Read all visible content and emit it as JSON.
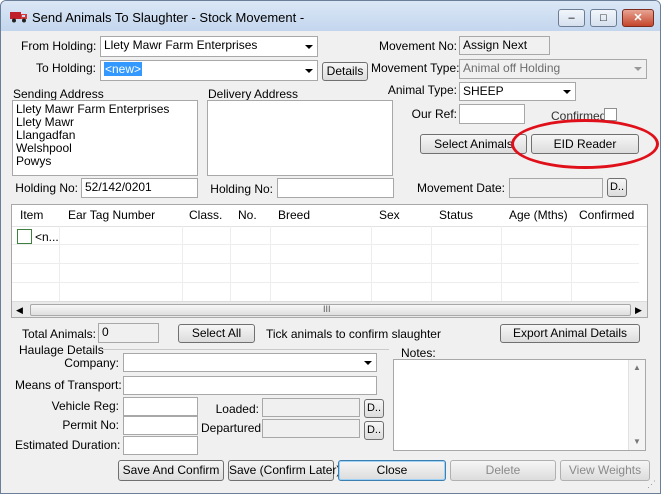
{
  "window": {
    "title": "Send Animals To Slaughter - Stock Movement -",
    "minimize_glyph": "–",
    "maximize_glyph": "□",
    "close_glyph": "✕"
  },
  "from_holding": {
    "label": "From Holding:",
    "value": "Llety Mawr Farm Enterprises"
  },
  "to_holding": {
    "label": "To Holding:",
    "value": "<new>",
    "details_button": "Details"
  },
  "movement_no": {
    "label": "Movement No:",
    "value": "Assign Next"
  },
  "movement_type": {
    "label": "Movement Type:",
    "value": "Animal off Holding"
  },
  "animal_type": {
    "label": "Animal Type:",
    "value": "SHEEP"
  },
  "our_ref": {
    "label": "Our Ref:",
    "value": ""
  },
  "confirmed": {
    "label": "Confirmed"
  },
  "sending_address": {
    "label": "Sending Address",
    "lines": [
      "Llety Mawr Farm Enterprises",
      "Llety Mawr",
      "Llangadfan",
      "Welshpool",
      "Powys"
    ]
  },
  "delivery_address": {
    "label": "Delivery Address"
  },
  "buttons": {
    "select_animals": "Select Animals",
    "eid_reader": "EID Reader",
    "select_all": "Select All",
    "export_animal_details": "Export Animal Details",
    "save_and_confirm": "Save And Confirm",
    "save_confirm_later": "Save (Confirm Later)",
    "close": "Close",
    "delete": "Delete",
    "view_weights": "View Weights",
    "date_picker": "D.."
  },
  "sending_holding_no": {
    "label": "Holding No:",
    "value": "52/142/0201"
  },
  "delivery_holding_no": {
    "label": "Holding No:",
    "value": ""
  },
  "movement_date": {
    "label": "Movement Date:",
    "value": ""
  },
  "table": {
    "columns": [
      "Item",
      "Ear Tag Number",
      "Class.",
      "No.",
      "Breed",
      "Sex",
      "Status",
      "Age (Mths)",
      "Confirmed"
    ],
    "rows": [
      {
        "item": "<n..."
      }
    ],
    "scroll_grip": "III"
  },
  "total_animals": {
    "label": "Total Animals:",
    "value": "0"
  },
  "tick_hint": "Tick animals to confirm slaughter",
  "haulage": {
    "heading": "Haulage Details",
    "company_label": "Company:",
    "means_label": "Means of Transport:",
    "vehicle_label": "Vehicle Reg:",
    "permit_label": "Permit No:",
    "duration_label": "Estimated Duration:",
    "loaded_label": "Loaded:",
    "departured_label": "Departured:"
  },
  "notes": {
    "label": "Notes:"
  },
  "colors": {
    "highlight_ring": "#e0101a",
    "selected_text_bg": "#3399ff"
  }
}
